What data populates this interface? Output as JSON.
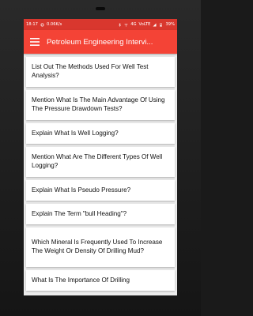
{
  "status": {
    "time": "18:17",
    "network_speed": "0.06K/s",
    "network": "4G",
    "volte": "VoLTE",
    "battery": "39%"
  },
  "app": {
    "title": "Petroleum Engineering Intervi..."
  },
  "questions": [
    "List Out The Methods Used For Well Test Analysis?",
    "Mention What Is The Main Advantage Of Using The Pressure Drawdown Tests?",
    "Explain What Is Well Logging?",
    "Mention What Are The Different Types Of Well Logging?",
    "Explain What Is Pseudo Pressure?",
    "Explain The Term \"bull Heading\"?",
    "Which Mineral Is Frequently Used To Increase The Weight Or Density Of Drilling Mud?",
    "What Is The Importance Of Drilling"
  ],
  "colors": {
    "appbar": "#f44336",
    "statusbar": "#d9372e"
  },
  "icons": {
    "menu": "hamburger-menu-icon"
  }
}
